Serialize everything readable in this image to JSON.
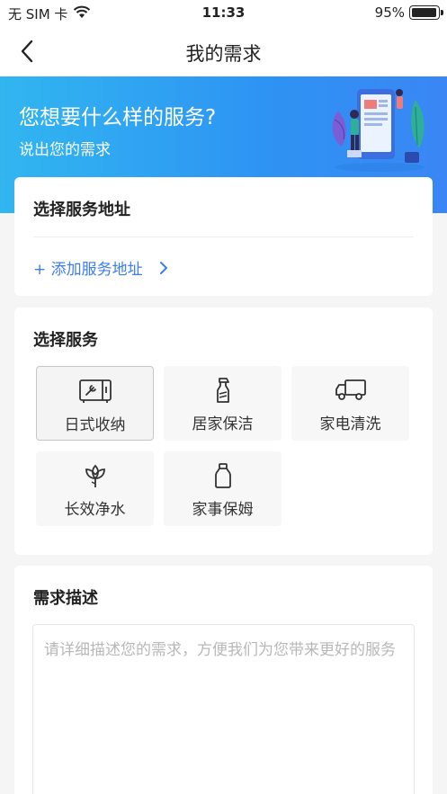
{
  "status_bar": {
    "carrier": "无 SIM 卡",
    "time": "11:33",
    "battery": "95%",
    "battery_level": 0.95,
    "icons": [
      "wifi-icon",
      "battery-icon"
    ]
  },
  "nav": {
    "title": "我的需求",
    "back_icon": "chevron-left-icon"
  },
  "banner": {
    "headline": "您想要什么样的服务?",
    "subline": "说出您的需求",
    "illustration": "person-with-phone-illustration"
  },
  "address": {
    "title": "选择服务地址",
    "add_label": "+ 添加服务地址",
    "add_icon": "chevron-right-icon"
  },
  "services": {
    "title": "选择服务",
    "items": [
      {
        "label": "日式收纳",
        "icon": "storage-cabinet-icon",
        "selected": true
      },
      {
        "label": "居家保洁",
        "icon": "spray-bottle-icon",
        "selected": false
      },
      {
        "label": "家电清洗",
        "icon": "truck-icon",
        "selected": false
      },
      {
        "label": "长效净水",
        "icon": "flower-icon",
        "selected": false
      },
      {
        "label": "家事保姆",
        "icon": "bottle-icon",
        "selected": false
      }
    ]
  },
  "description": {
    "title": "需求描述",
    "placeholder": "请详细描述您的需求，方便我们为您带来更好的服务"
  },
  "colors": {
    "accent": "#3c7df0",
    "banner_start": "#31b6f0",
    "banner_end": "#3a86f5"
  }
}
